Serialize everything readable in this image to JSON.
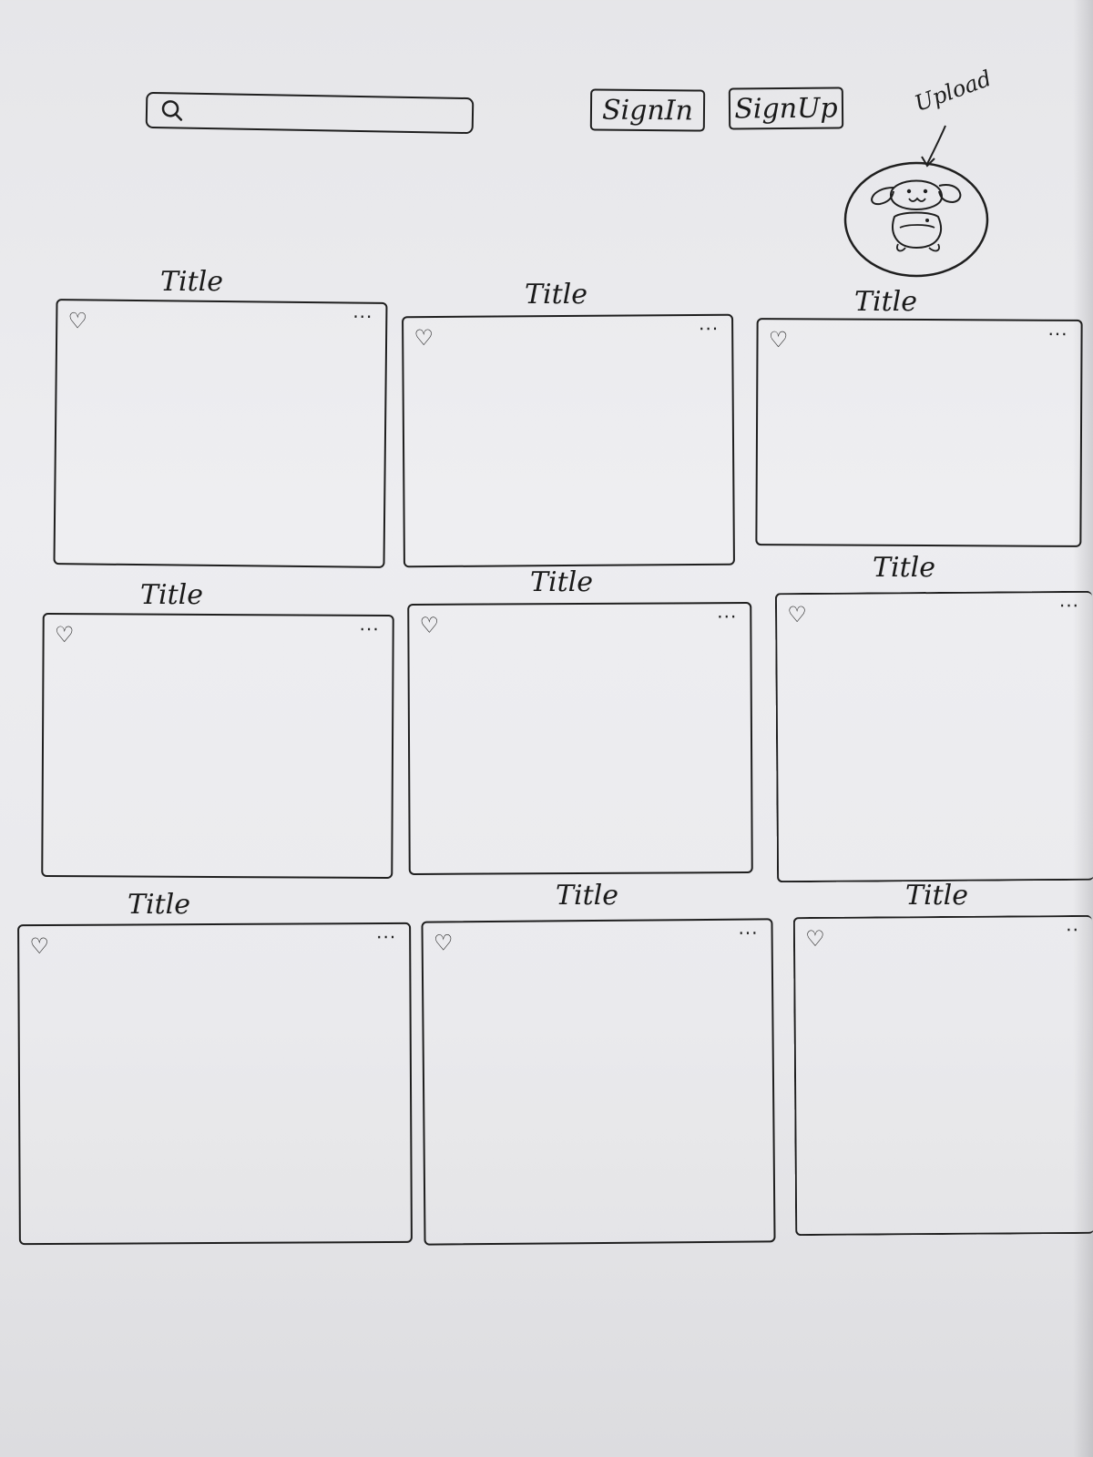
{
  "header": {
    "search_placeholder": "",
    "signin_label": "SignIn",
    "signup_label": "SignUp",
    "upload_label": "Upload"
  },
  "cards": [
    {
      "title": "Title"
    },
    {
      "title": "Title"
    },
    {
      "title": "Title"
    },
    {
      "title": "Title"
    },
    {
      "title": "Title"
    },
    {
      "title": "Title"
    },
    {
      "title": "Title"
    },
    {
      "title": "Title"
    },
    {
      "title": "Title"
    }
  ],
  "icons": {
    "search": "search-icon",
    "heart": "heart-icon",
    "more": "more-options-icon",
    "avatar": "dog-avatar-icon"
  }
}
